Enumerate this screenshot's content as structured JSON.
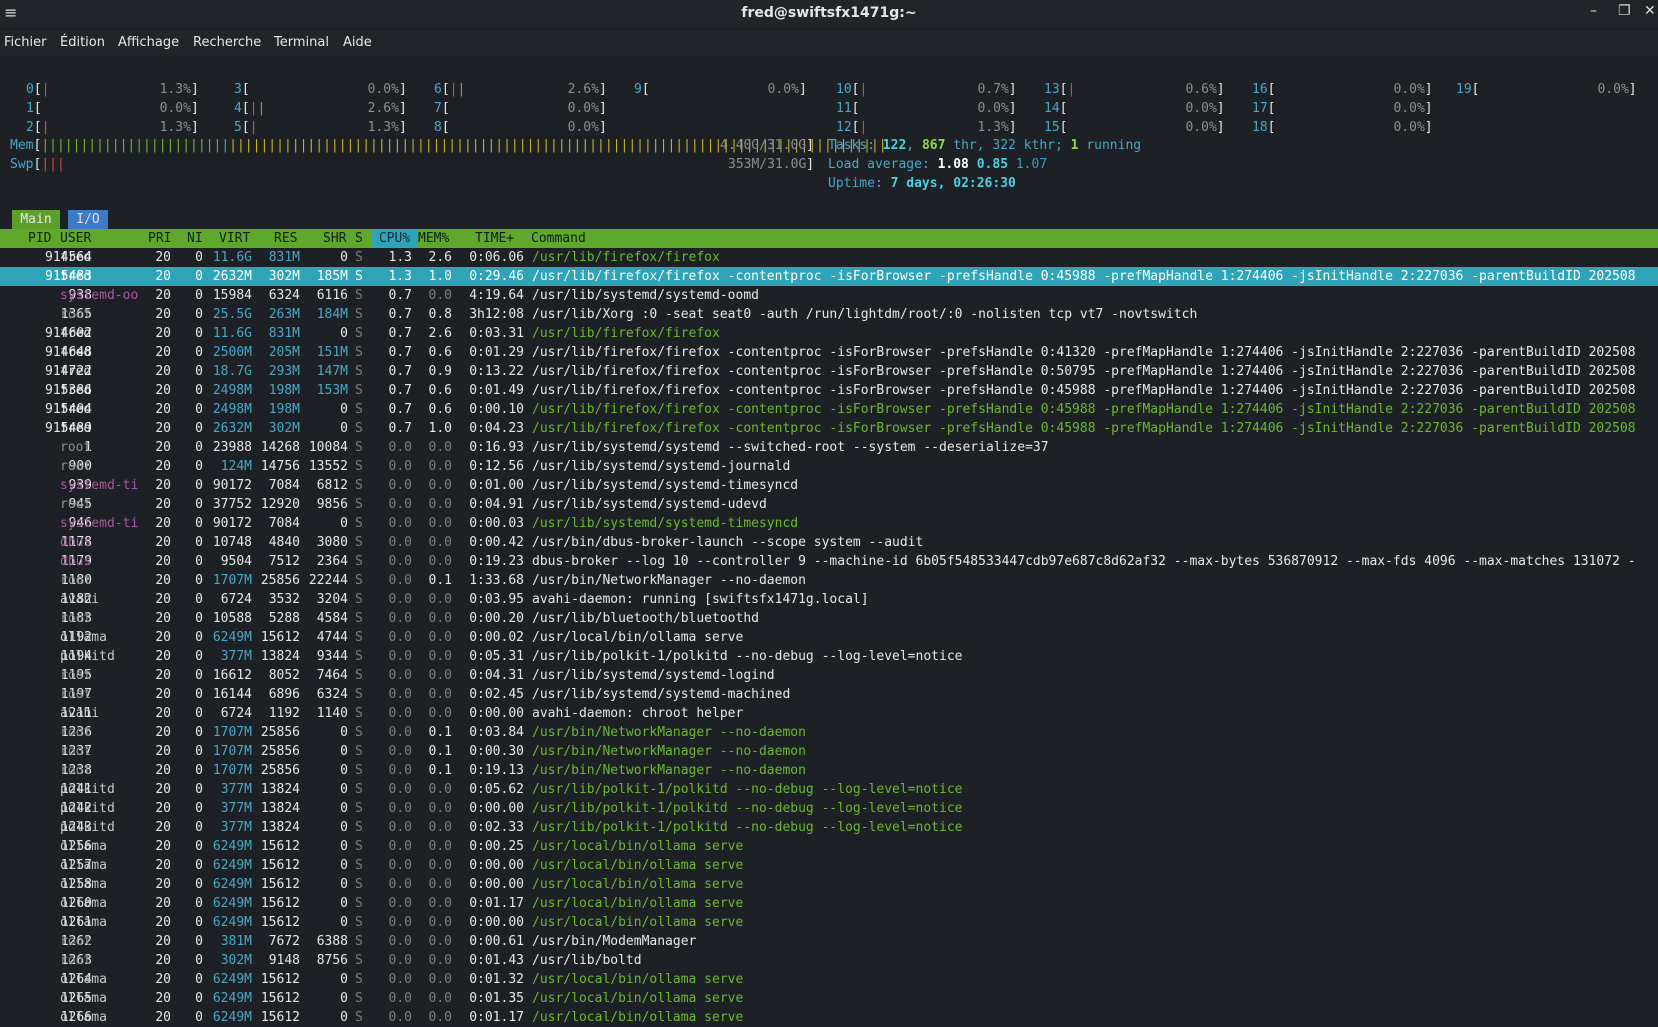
{
  "window": {
    "title": "fred@swiftsfx1471g:~"
  },
  "menu": [
    "Fichier",
    "Édition",
    "Affichage",
    "Recherche",
    "Terminal",
    "Aide"
  ],
  "cpus": [
    {
      "id": "0",
      "pct": "1.3%"
    },
    {
      "id": "1",
      "pct": "0.0%"
    },
    {
      "id": "2",
      "pct": "1.3%"
    },
    {
      "id": "3",
      "pct": "0.0%"
    },
    {
      "id": "4",
      "pct": "2.6%"
    },
    {
      "id": "5",
      "pct": "1.3%"
    },
    {
      "id": "6",
      "pct": "2.6%"
    },
    {
      "id": "7",
      "pct": "0.0%"
    },
    {
      "id": "8",
      "pct": "0.0%"
    },
    {
      "id": "9",
      "pct": "0.0%"
    },
    {
      "id": "10",
      "pct": "0.7%"
    },
    {
      "id": "11",
      "pct": "0.0%"
    },
    {
      "id": "12",
      "pct": "1.3%"
    },
    {
      "id": "13",
      "pct": "0.6%"
    },
    {
      "id": "14",
      "pct": "0.0%"
    },
    {
      "id": "15",
      "pct": "0.0%"
    },
    {
      "id": "16",
      "pct": "0.0%"
    },
    {
      "id": "17",
      "pct": "0.0%"
    },
    {
      "id": "18",
      "pct": "0.0%"
    },
    {
      "id": "19",
      "pct": "0.0%"
    }
  ],
  "mem": {
    "label": "Mem",
    "value": "4.40G/31.0G"
  },
  "swp": {
    "label": "Swp",
    "value": "353M/31.0G"
  },
  "tasks": {
    "label": "Tasks:",
    "count": "122",
    "thr": "867",
    "thr_label": "thr,",
    "kthr": "322 kthr;",
    "running": "1",
    "running_label": "running"
  },
  "load": {
    "label": "Load average:",
    "v1": "1.08",
    "v5": "0.85",
    "v15": "1.07"
  },
  "uptime": {
    "label": "Uptime:",
    "value": "7 days, 02:26:30"
  },
  "tabs": {
    "main": "Main",
    "io": "I/O"
  },
  "columns": {
    "pid": "PID",
    "user": "USER",
    "pri": "PRI",
    "ni": "NI",
    "virt": "VIRT",
    "res": "RES",
    "shr": "SHR",
    "s": "S",
    "cpu": "CPU%",
    "mem": "MEM%",
    "time": "TIME+",
    "cmd": "Command"
  },
  "processes": [
    {
      "pid": "914564",
      "user": "fred",
      "pri": "20",
      "ni": "0",
      "virt": "11.6G",
      "res": "831M",
      "shr": "0",
      "s": "S",
      "cpu": "1.3",
      "mem": "2.6",
      "time": "0:06.06",
      "cmd": "/usr/lib/firefox/firefox",
      "thread": true
    },
    {
      "pid": "915483",
      "user": "fred",
      "pri": "20",
      "ni": "0",
      "virt": "2632M",
      "res": "302M",
      "shr": "185M",
      "s": "S",
      "cpu": "1.3",
      "mem": "1.0",
      "time": "0:29.46",
      "cmd": "/usr/lib/firefox/firefox -contentproc -isForBrowser -prefsHandle 0:45988 -prefMapHandle 1:274406 -jsInitHandle 2:227036 -parentBuildID 202508",
      "selected": true
    },
    {
      "pid": "938",
      "user": "systemd-oo",
      "pri": "20",
      "ni": "0",
      "virt": "15984",
      "res": "6324",
      "shr": "6116",
      "s": "S",
      "cpu": "0.7",
      "mem": "0.0",
      "time": "4:19.64",
      "cmd": "/usr/lib/systemd/systemd-oomd"
    },
    {
      "pid": "1365",
      "user": "root",
      "pri": "20",
      "ni": "0",
      "virt": "25.5G",
      "res": "263M",
      "shr": "184M",
      "s": "S",
      "cpu": "0.7",
      "mem": "0.8",
      "time": "3h12:08",
      "cmd": "/usr/lib/Xorg :0 -seat seat0 -auth /run/lightdm/root/:0 -nolisten tcp vt7 -novtswitch"
    },
    {
      "pid": "914602",
      "user": "fred",
      "pri": "20",
      "ni": "0",
      "virt": "11.6G",
      "res": "831M",
      "shr": "0",
      "s": "S",
      "cpu": "0.7",
      "mem": "2.6",
      "time": "0:03.31",
      "cmd": "/usr/lib/firefox/firefox",
      "thread": true
    },
    {
      "pid": "914648",
      "user": "fred",
      "pri": "20",
      "ni": "0",
      "virt": "2500M",
      "res": "205M",
      "shr": "151M",
      "s": "S",
      "cpu": "0.7",
      "mem": "0.6",
      "time": "0:01.29",
      "cmd": "/usr/lib/firefox/firefox -contentproc -isForBrowser -prefsHandle 0:41320 -prefMapHandle 1:274406 -jsInitHandle 2:227036 -parentBuildID 202508"
    },
    {
      "pid": "914722",
      "user": "fred",
      "pri": "20",
      "ni": "0",
      "virt": "18.7G",
      "res": "293M",
      "shr": "147M",
      "s": "S",
      "cpu": "0.7",
      "mem": "0.9",
      "time": "0:13.22",
      "cmd": "/usr/lib/firefox/firefox -contentproc -isForBrowser -prefsHandle 0:50795 -prefMapHandle 1:274406 -jsInitHandle 2:227036 -parentBuildID 202508"
    },
    {
      "pid": "915386",
      "user": "fred",
      "pri": "20",
      "ni": "0",
      "virt": "2498M",
      "res": "198M",
      "shr": "153M",
      "s": "S",
      "cpu": "0.7",
      "mem": "0.6",
      "time": "0:01.49",
      "cmd": "/usr/lib/firefox/firefox -contentproc -isForBrowser -prefsHandle 0:45988 -prefMapHandle 1:274406 -jsInitHandle 2:227036 -parentBuildID 202508"
    },
    {
      "pid": "915404",
      "user": "fred",
      "pri": "20",
      "ni": "0",
      "virt": "2498M",
      "res": "198M",
      "shr": "0",
      "s": "S",
      "cpu": "0.7",
      "mem": "0.6",
      "time": "0:00.10",
      "cmd": "/usr/lib/firefox/firefox -contentproc -isForBrowser -prefsHandle 0:45988 -prefMapHandle 1:274406 -jsInitHandle 2:227036 -parentBuildID 202508",
      "thread": true
    },
    {
      "pid": "915489",
      "user": "fred",
      "pri": "20",
      "ni": "0",
      "virt": "2632M",
      "res": "302M",
      "shr": "0",
      "s": "S",
      "cpu": "0.7",
      "mem": "1.0",
      "time": "0:04.23",
      "cmd": "/usr/lib/firefox/firefox -contentproc -isForBrowser -prefsHandle 0:45988 -prefMapHandle 1:274406 -jsInitHandle 2:227036 -parentBuildID 202508",
      "thread": true
    },
    {
      "pid": "1",
      "user": "root",
      "pri": "20",
      "ni": "0",
      "virt": "23988",
      "res": "14268",
      "shr": "10084",
      "s": "S",
      "cpu": "0.0",
      "mem": "0.0",
      "time": "0:16.93",
      "cmd": "/usr/lib/systemd/systemd --switched-root --system --deserialize=37"
    },
    {
      "pid": "900",
      "user": "root",
      "pri": "20",
      "ni": "0",
      "virt": "124M",
      "res": "14756",
      "shr": "13552",
      "s": "S",
      "cpu": "0.0",
      "mem": "0.0",
      "time": "0:12.56",
      "cmd": "/usr/lib/systemd/systemd-journald"
    },
    {
      "pid": "939",
      "user": "systemd-ti",
      "pri": "20",
      "ni": "0",
      "virt": "90172",
      "res": "7084",
      "shr": "6812",
      "s": "S",
      "cpu": "0.0",
      "mem": "0.0",
      "time": "0:01.00",
      "cmd": "/usr/lib/systemd/systemd-timesyncd"
    },
    {
      "pid": "945",
      "user": "root",
      "pri": "20",
      "ni": "0",
      "virt": "37752",
      "res": "12920",
      "shr": "9856",
      "s": "S",
      "cpu": "0.0",
      "mem": "0.0",
      "time": "0:04.91",
      "cmd": "/usr/lib/systemd/systemd-udevd"
    },
    {
      "pid": "946",
      "user": "systemd-ti",
      "pri": "20",
      "ni": "0",
      "virt": "90172",
      "res": "7084",
      "shr": "0",
      "s": "S",
      "cpu": "0.0",
      "mem": "0.0",
      "time": "0:00.03",
      "cmd": "/usr/lib/systemd/systemd-timesyncd",
      "thread": true
    },
    {
      "pid": "1178",
      "user": "dbus",
      "pri": "20",
      "ni": "0",
      "virt": "10748",
      "res": "4840",
      "shr": "3080",
      "s": "S",
      "cpu": "0.0",
      "mem": "0.0",
      "time": "0:00.42",
      "cmd": "/usr/bin/dbus-broker-launch --scope system --audit"
    },
    {
      "pid": "1179",
      "user": "dbus",
      "pri": "20",
      "ni": "0",
      "virt": "9504",
      "res": "7512",
      "shr": "2364",
      "s": "S",
      "cpu": "0.0",
      "mem": "0.0",
      "time": "0:19.23",
      "cmd": "dbus-broker --log 10 --controller 9 --machine-id 6b05f548533447cdb97e687c8d62af32 --max-bytes 536870912 --max-fds 4096 --max-matches 131072 -"
    },
    {
      "pid": "1180",
      "user": "root",
      "pri": "20",
      "ni": "0",
      "virt": "1707M",
      "res": "25856",
      "shr": "22244",
      "s": "S",
      "cpu": "0.0",
      "mem": "0.1",
      "time": "1:33.68",
      "cmd": "/usr/bin/NetworkManager --no-daemon"
    },
    {
      "pid": "1182",
      "user": "avahi",
      "pri": "20",
      "ni": "0",
      "virt": "6724",
      "res": "3532",
      "shr": "3204",
      "s": "S",
      "cpu": "0.0",
      "mem": "0.0",
      "time": "0:03.95",
      "cmd": "avahi-daemon: running [swiftsfx1471g.local]"
    },
    {
      "pid": "1183",
      "user": "root",
      "pri": "20",
      "ni": "0",
      "virt": "10588",
      "res": "5288",
      "shr": "4584",
      "s": "S",
      "cpu": "0.0",
      "mem": "0.0",
      "time": "0:00.20",
      "cmd": "/usr/lib/bluetooth/bluetoothd"
    },
    {
      "pid": "1192",
      "user": "ollama",
      "pri": "20",
      "ni": "0",
      "virt": "6249M",
      "res": "15612",
      "shr": "4744",
      "s": "S",
      "cpu": "0.0",
      "mem": "0.0",
      "time": "0:00.02",
      "cmd": "/usr/local/bin/ollama serve"
    },
    {
      "pid": "1194",
      "user": "polkitd",
      "pri": "20",
      "ni": "0",
      "virt": "377M",
      "res": "13824",
      "shr": "9344",
      "s": "S",
      "cpu": "0.0",
      "mem": "0.0",
      "time": "0:05.31",
      "cmd": "/usr/lib/polkit-1/polkitd --no-debug --log-level=notice"
    },
    {
      "pid": "1195",
      "user": "root",
      "pri": "20",
      "ni": "0",
      "virt": "16612",
      "res": "8052",
      "shr": "7464",
      "s": "S",
      "cpu": "0.0",
      "mem": "0.0",
      "time": "0:04.31",
      "cmd": "/usr/lib/systemd/systemd-logind"
    },
    {
      "pid": "1197",
      "user": "root",
      "pri": "20",
      "ni": "0",
      "virt": "16144",
      "res": "6896",
      "shr": "6324",
      "s": "S",
      "cpu": "0.0",
      "mem": "0.0",
      "time": "0:02.45",
      "cmd": "/usr/lib/systemd/systemd-machined"
    },
    {
      "pid": "1211",
      "user": "avahi",
      "pri": "20",
      "ni": "0",
      "virt": "6724",
      "res": "1192",
      "shr": "1140",
      "s": "S",
      "cpu": "0.0",
      "mem": "0.0",
      "time": "0:00.00",
      "cmd": "avahi-daemon: chroot helper"
    },
    {
      "pid": "1236",
      "user": "root",
      "pri": "20",
      "ni": "0",
      "virt": "1707M",
      "res": "25856",
      "shr": "0",
      "s": "S",
      "cpu": "0.0",
      "mem": "0.1",
      "time": "0:03.84",
      "cmd": "/usr/bin/NetworkManager --no-daemon",
      "thread": true
    },
    {
      "pid": "1237",
      "user": "root",
      "pri": "20",
      "ni": "0",
      "virt": "1707M",
      "res": "25856",
      "shr": "0",
      "s": "S",
      "cpu": "0.0",
      "mem": "0.1",
      "time": "0:00.30",
      "cmd": "/usr/bin/NetworkManager --no-daemon",
      "thread": true
    },
    {
      "pid": "1238",
      "user": "root",
      "pri": "20",
      "ni": "0",
      "virt": "1707M",
      "res": "25856",
      "shr": "0",
      "s": "S",
      "cpu": "0.0",
      "mem": "0.1",
      "time": "0:19.13",
      "cmd": "/usr/bin/NetworkManager --no-daemon",
      "thread": true
    },
    {
      "pid": "1241",
      "user": "polkitd",
      "pri": "20",
      "ni": "0",
      "virt": "377M",
      "res": "13824",
      "shr": "0",
      "s": "S",
      "cpu": "0.0",
      "mem": "0.0",
      "time": "0:05.62",
      "cmd": "/usr/lib/polkit-1/polkitd --no-debug --log-level=notice",
      "thread": true
    },
    {
      "pid": "1242",
      "user": "polkitd",
      "pri": "20",
      "ni": "0",
      "virt": "377M",
      "res": "13824",
      "shr": "0",
      "s": "S",
      "cpu": "0.0",
      "mem": "0.0",
      "time": "0:00.00",
      "cmd": "/usr/lib/polkit-1/polkitd --no-debug --log-level=notice",
      "thread": true
    },
    {
      "pid": "1243",
      "user": "polkitd",
      "pri": "20",
      "ni": "0",
      "virt": "377M",
      "res": "13824",
      "shr": "0",
      "s": "S",
      "cpu": "0.0",
      "mem": "0.0",
      "time": "0:02.33",
      "cmd": "/usr/lib/polkit-1/polkitd --no-debug --log-level=notice",
      "thread": true
    },
    {
      "pid": "1256",
      "user": "ollama",
      "pri": "20",
      "ni": "0",
      "virt": "6249M",
      "res": "15612",
      "shr": "0",
      "s": "S",
      "cpu": "0.0",
      "mem": "0.0",
      "time": "0:00.25",
      "cmd": "/usr/local/bin/ollama serve",
      "thread": true
    },
    {
      "pid": "1257",
      "user": "ollama",
      "pri": "20",
      "ni": "0",
      "virt": "6249M",
      "res": "15612",
      "shr": "0",
      "s": "S",
      "cpu": "0.0",
      "mem": "0.0",
      "time": "0:00.00",
      "cmd": "/usr/local/bin/ollama serve",
      "thread": true
    },
    {
      "pid": "1258",
      "user": "ollama",
      "pri": "20",
      "ni": "0",
      "virt": "6249M",
      "res": "15612",
      "shr": "0",
      "s": "S",
      "cpu": "0.0",
      "mem": "0.0",
      "time": "0:00.00",
      "cmd": "/usr/local/bin/ollama serve",
      "thread": true
    },
    {
      "pid": "1260",
      "user": "ollama",
      "pri": "20",
      "ni": "0",
      "virt": "6249M",
      "res": "15612",
      "shr": "0",
      "s": "S",
      "cpu": "0.0",
      "mem": "0.0",
      "time": "0:01.17",
      "cmd": "/usr/local/bin/ollama serve",
      "thread": true
    },
    {
      "pid": "1261",
      "user": "ollama",
      "pri": "20",
      "ni": "0",
      "virt": "6249M",
      "res": "15612",
      "shr": "0",
      "s": "S",
      "cpu": "0.0",
      "mem": "0.0",
      "time": "0:00.00",
      "cmd": "/usr/local/bin/ollama serve",
      "thread": true
    },
    {
      "pid": "1262",
      "user": "root",
      "pri": "20",
      "ni": "0",
      "virt": "381M",
      "res": "7672",
      "shr": "6388",
      "s": "S",
      "cpu": "0.0",
      "mem": "0.0",
      "time": "0:00.61",
      "cmd": "/usr/bin/ModemManager"
    },
    {
      "pid": "1263",
      "user": "root",
      "pri": "20",
      "ni": "0",
      "virt": "302M",
      "res": "9148",
      "shr": "8756",
      "s": "S",
      "cpu": "0.0",
      "mem": "0.0",
      "time": "0:01.43",
      "cmd": "/usr/lib/boltd"
    },
    {
      "pid": "1264",
      "user": "ollama",
      "pri": "20",
      "ni": "0",
      "virt": "6249M",
      "res": "15612",
      "shr": "0",
      "s": "S",
      "cpu": "0.0",
      "mem": "0.0",
      "time": "0:01.32",
      "cmd": "/usr/local/bin/ollama serve",
      "thread": true
    },
    {
      "pid": "1265",
      "user": "ollama",
      "pri": "20",
      "ni": "0",
      "virt": "6249M",
      "res": "15612",
      "shr": "0",
      "s": "S",
      "cpu": "0.0",
      "mem": "0.0",
      "time": "0:01.35",
      "cmd": "/usr/local/bin/ollama serve",
      "thread": true
    },
    {
      "pid": "1266",
      "user": "ollama",
      "pri": "20",
      "ni": "0",
      "virt": "6249M",
      "res": "15612",
      "shr": "0",
      "s": "S",
      "cpu": "0.0",
      "mem": "0.0",
      "time": "0:01.17",
      "cmd": "/usr/local/bin/ollama serve",
      "thread": true
    }
  ]
}
